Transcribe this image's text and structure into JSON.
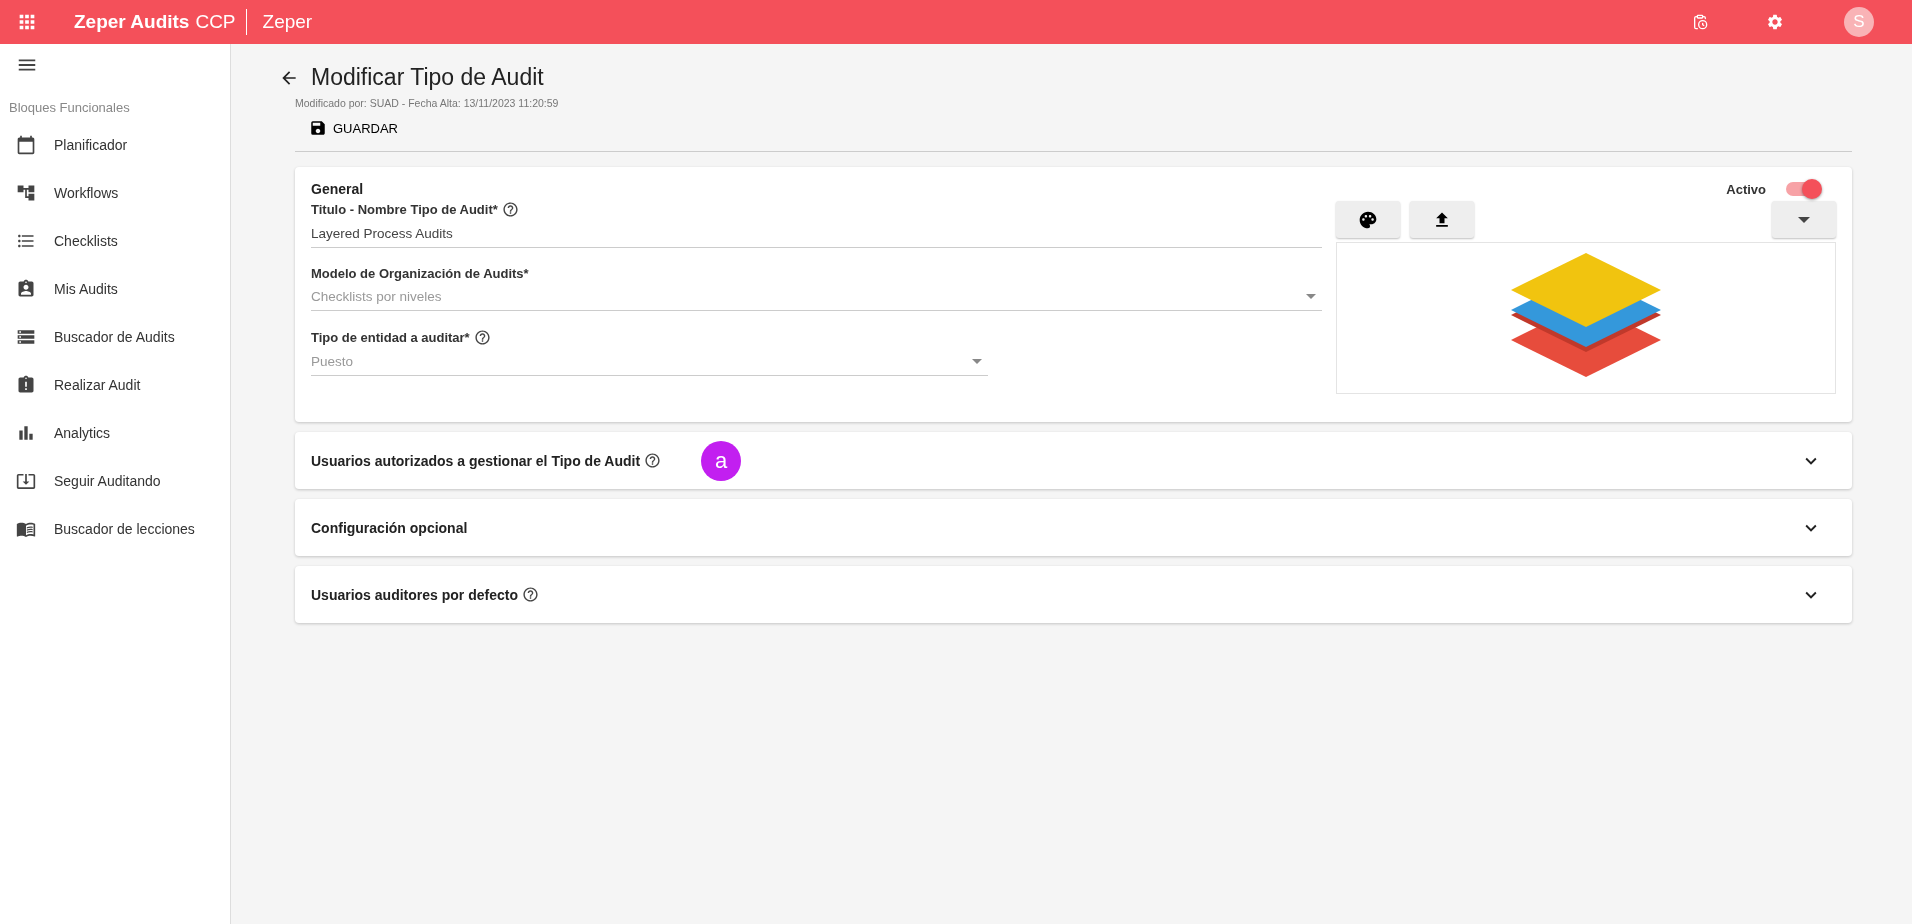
{
  "app_bar": {
    "app_name": "Zeper Audits",
    "app_suffix": "CCP",
    "company": "Zeper",
    "avatar": "S"
  },
  "sidebar": {
    "section_title": "Bloques Funcionales",
    "items": [
      {
        "label": "Planificador"
      },
      {
        "label": "Workflows"
      },
      {
        "label": "Checklists"
      },
      {
        "label": "Mis Audits"
      },
      {
        "label": "Buscador de Audits"
      },
      {
        "label": "Realizar Audit"
      },
      {
        "label": "Analytics"
      },
      {
        "label": "Seguir Auditando"
      },
      {
        "label": "Buscador de lecciones"
      }
    ]
  },
  "page": {
    "title": "Modificar Tipo de Audit",
    "subtitle": "Modificado por: SUAD - Fecha Alta: 13/11/2023 11:20:59",
    "save_button": "GUARDAR"
  },
  "general": {
    "title": "General",
    "active_label": "Activo",
    "active_on": true,
    "fields": [
      {
        "label": "Titulo - Nombre Tipo de Audit*",
        "help": true,
        "kind": "text",
        "value": "Layered Process Audits"
      },
      {
        "label": "Modelo de Organización de Audits*",
        "help": false,
        "kind": "select",
        "placeholder": "Checklists por niveles"
      },
      {
        "label": "Tipo de entidad a auditar*",
        "help": true,
        "kind": "select",
        "placeholder": "Puesto"
      }
    ]
  },
  "sections": [
    {
      "title": "Usuarios autorizados a gestionar el Tipo de Audit",
      "help": true,
      "expanded": false,
      "badge": "a"
    },
    {
      "title": "Configuración opcional",
      "help": false,
      "expanded": false
    },
    {
      "title": "Usuarios auditores por defecto",
      "help": true,
      "expanded": false
    }
  ]
}
